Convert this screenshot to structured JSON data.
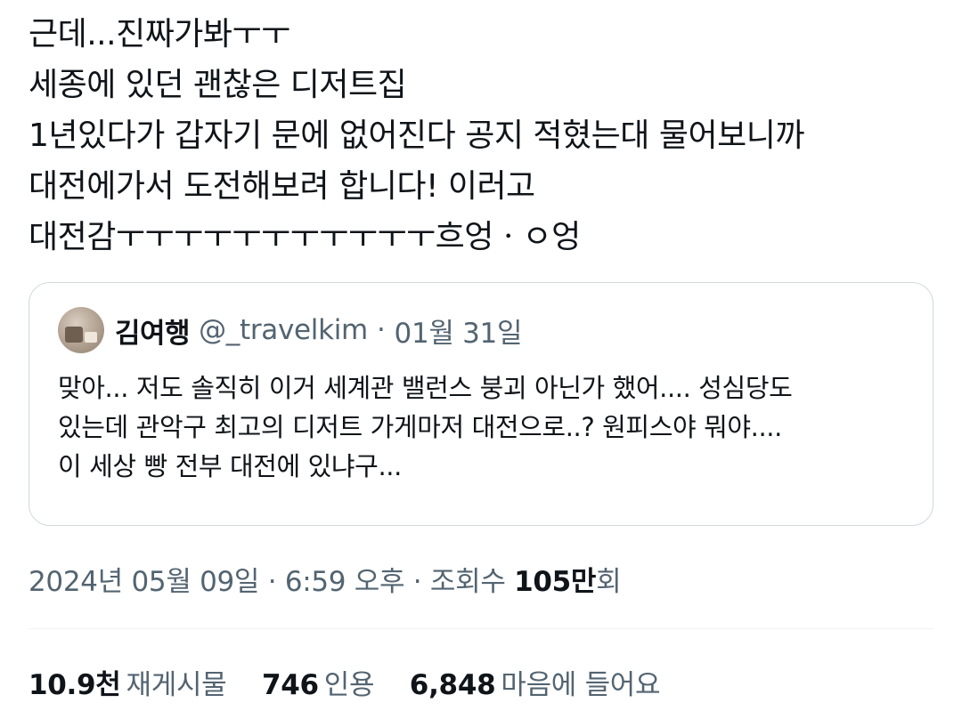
{
  "tweet": {
    "lines": [
      "근데...진짜가봐ㅜㅜ",
      "세종에 있던 괜찮은 디저트집",
      "1년있다가 갑자기 문에 없어진다 공지 적혔는대 물어보니까",
      "대전에가서 도전해보려 합니다! 이러고",
      "대전감ㅜㅜㅜㅜㅜㅜㅜㅜㅜㅜㅜ흐엉ㆍㅇ엉"
    ]
  },
  "quote": {
    "author_name": "김여행",
    "author_handle": "@_travelkim",
    "separator": "·",
    "date": "01월 31일",
    "lines": [
      "맞아... 저도 솔직히 이거 세계관 밸런스 붕괴 아닌가 했어.... 성심당도",
      "있는데 관악구 최고의 디저트 가게마저 대전으로..? 원피스야 뭐야....",
      "이 세상 빵 전부 대전에 있냐구..."
    ]
  },
  "meta": {
    "timestamp": "2024년 05월 09일 · 6:59 오후 · 조회수 ",
    "views_strong": "105만",
    "views_suffix": "회"
  },
  "stats": {
    "retweets_num": "10.9천",
    "retweets_label": "재게시물",
    "quotes_num": "746",
    "quotes_label": "인용",
    "likes_num": "6,848",
    "likes_label": "마음에 들어요"
  },
  "colors": {
    "text_primary": "#0f1419",
    "text_secondary": "#536471",
    "border": "#cfd9de",
    "divider": "#eff3f4"
  }
}
